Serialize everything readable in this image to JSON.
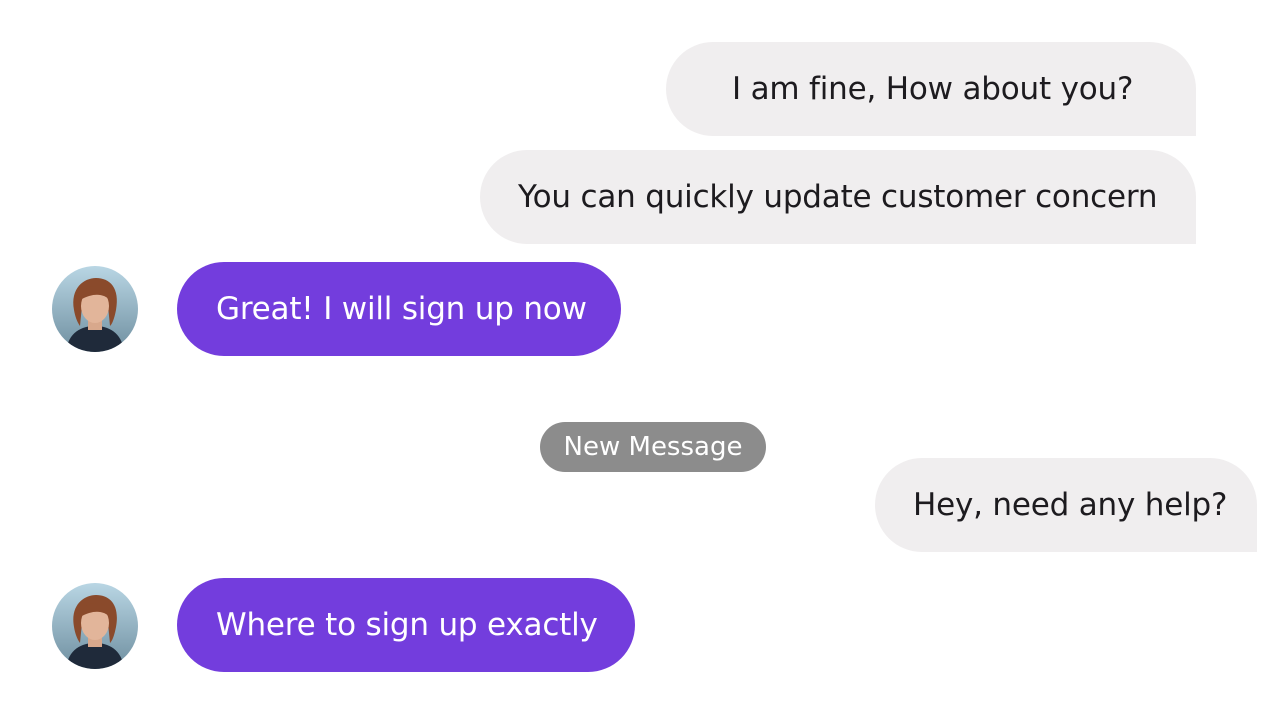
{
  "messages": [
    {
      "text": "I am fine, How about you?",
      "direction": "outgoing"
    },
    {
      "text": "You can quickly update customer concern",
      "direction": "outgoing"
    },
    {
      "text": "Great! I will sign up now",
      "direction": "incoming"
    },
    {
      "text": "Hey, need any help?",
      "direction": "outgoing"
    },
    {
      "text": "Where to sign up exactly",
      "direction": "incoming"
    }
  ],
  "divider": {
    "label": "New Message"
  },
  "colors": {
    "incoming_bubble": "#733ddd",
    "outgoing_bubble": "#f0eeef",
    "badge": "#8c8c8c"
  },
  "icons": {
    "avatar": "user-avatar-photo"
  }
}
